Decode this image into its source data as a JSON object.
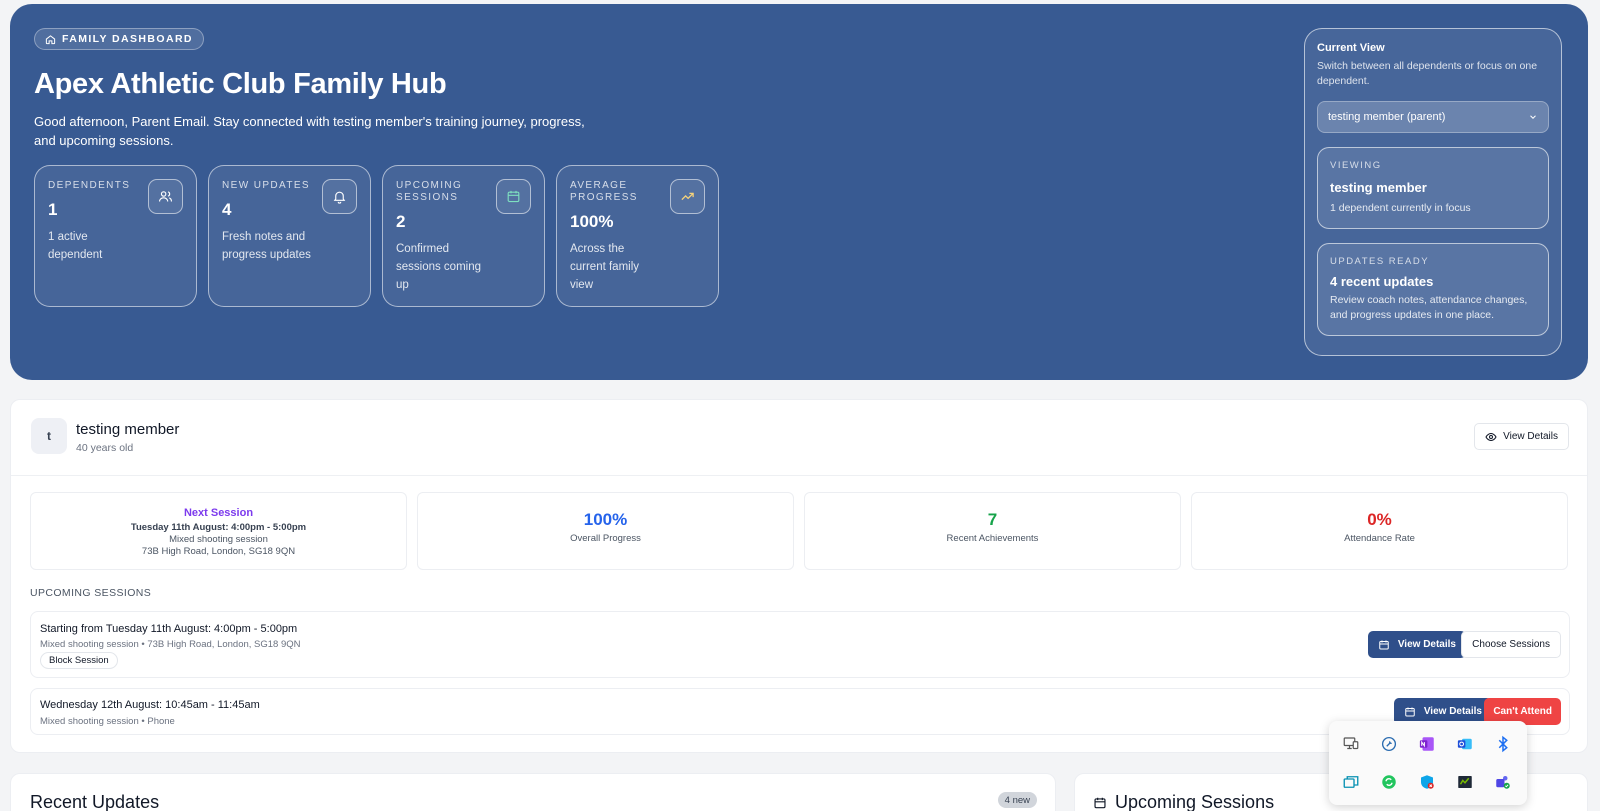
{
  "hero": {
    "badge": "FAMILY DASHBOARD",
    "title": "Apex Athletic Club Family Hub",
    "subtitle": "Good afternoon, Parent Email. Stay connected with testing member's training journey, progress, and upcoming sessions.",
    "stats": [
      {
        "label": "DEPENDENTS",
        "value": "1",
        "desc": "1 active dependent",
        "icon": "users-icon"
      },
      {
        "label": "NEW UPDATES",
        "value": "4",
        "desc": "Fresh notes and progress updates",
        "icon": "bell-icon"
      },
      {
        "label": "UPCOMING SESSIONS",
        "value": "2",
        "desc": "Confirmed sessions coming up",
        "icon": "calendar-icon"
      },
      {
        "label": "AVERAGE PROGRESS",
        "value": "100%",
        "desc": "Across the current family view",
        "icon": "trending-up-icon"
      }
    ]
  },
  "current_view": {
    "title": "Current View",
    "desc": "Switch between all dependents or focus on one dependent.",
    "selected": "testing member (parent)",
    "viewing": {
      "label": "VIEWING",
      "title": "testing member",
      "desc": "1 dependent currently in focus"
    },
    "updates": {
      "label": "UPDATES READY",
      "title": "4 recent updates",
      "desc": "Review coach notes, attendance changes, and progress updates in one place."
    }
  },
  "member": {
    "initial": "t",
    "name": "testing member",
    "age": "40 years old",
    "view_details": "View Details",
    "next_session": {
      "title": "Next Session",
      "time": "Tuesday 11th August: 4:00pm - 5:00pm",
      "type": "Mixed shooting session",
      "location": "73B High Road, London, SG18 9QN"
    },
    "metrics": [
      {
        "value": "100%",
        "label": "Overall Progress",
        "color": "#2563eb"
      },
      {
        "value": "7",
        "label": "Recent Achievements",
        "color": "#16a34a"
      },
      {
        "value": "0%",
        "label": "Attendance Rate",
        "color": "#dc2626"
      }
    ],
    "upcoming_label": "UPCOMING SESSIONS",
    "sessions": [
      {
        "title": "Starting from Tuesday 11th August: 4:00pm - 5:00pm",
        "meta": "Mixed shooting session • 73B High Road, London, SG18 9QN",
        "tag": "Block Session",
        "primary": "View Details",
        "secondary": "Choose Sessions"
      },
      {
        "title": "Wednesday 12th August: 10:45am - 11:45am",
        "meta": "Mixed shooting session • Phone",
        "primary": "View Details",
        "danger": "Can't Attend"
      }
    ]
  },
  "bottom": {
    "recent_updates": "Recent Updates",
    "new_badge": "4 new",
    "upcoming_sessions": "Upcoming Sessions"
  },
  "tray": [
    "display-icon",
    "wrench-icon",
    "onenote-icon",
    "outlook-icon",
    "bluetooth-icon",
    "window-icon",
    "sync-icon",
    "defender-icon",
    "nvidia-icon",
    "teams-icon"
  ]
}
